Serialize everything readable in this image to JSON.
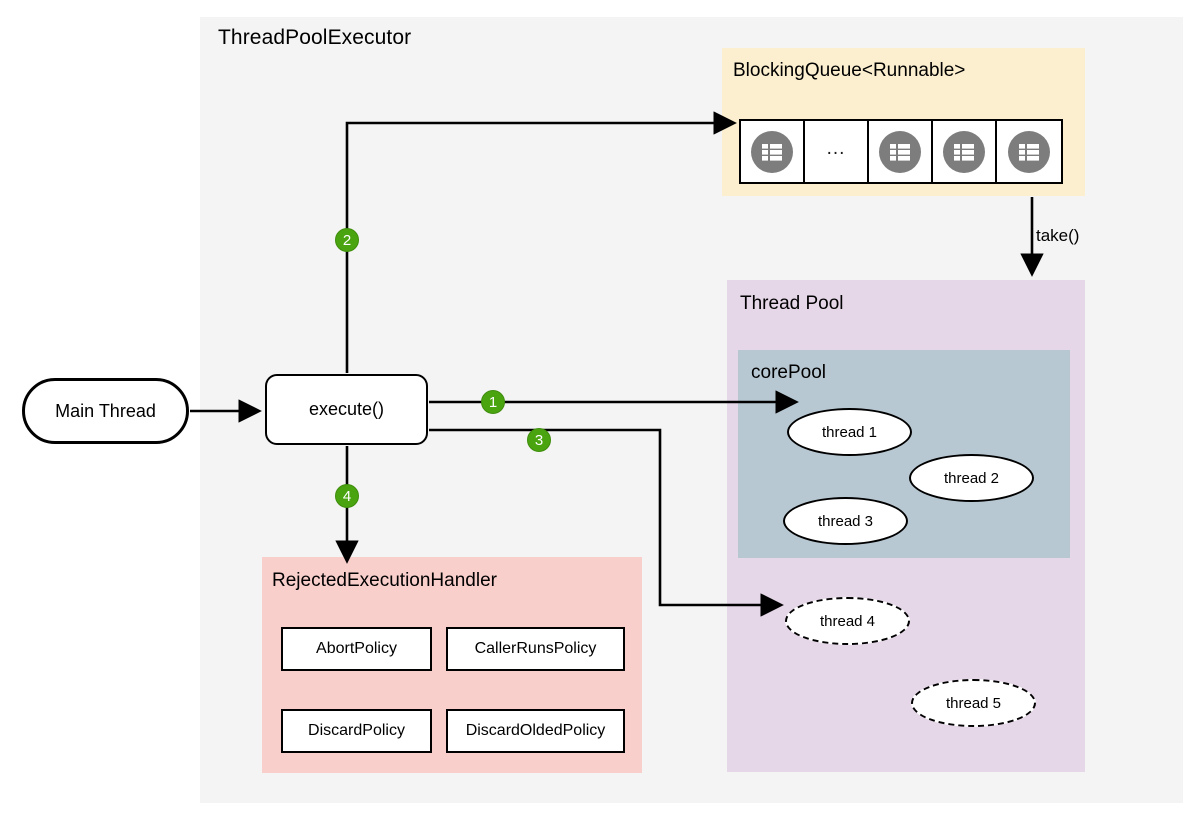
{
  "diagram": {
    "title": "ThreadPoolExecutor",
    "type": "flow-diagram"
  },
  "main_thread": {
    "label": "Main Thread"
  },
  "execute": {
    "label": "execute()"
  },
  "queue": {
    "title": "BlockingQueue<Runnable>",
    "cells": [
      {
        "kind": "task",
        "label": ""
      },
      {
        "kind": "ellipsis",
        "label": "..."
      },
      {
        "kind": "task",
        "label": ""
      },
      {
        "kind": "task",
        "label": ""
      },
      {
        "kind": "task",
        "label": ""
      }
    ],
    "icon_name": "task-list-icon",
    "background": "#fcefd0"
  },
  "thread_pool": {
    "title": "Thread Pool",
    "background": "#e5d6e8",
    "core_pool": {
      "title": "corePool",
      "background": "#b8c8d2",
      "threads": [
        {
          "label": "thread 1",
          "style": "solid"
        },
        {
          "label": "thread 2",
          "style": "solid"
        },
        {
          "label": "thread 3",
          "style": "solid"
        }
      ]
    },
    "extra_threads": [
      {
        "label": "thread 4",
        "style": "dashed"
      },
      {
        "label": "thread 5",
        "style": "dashed"
      }
    ]
  },
  "rejected_handler": {
    "title": "RejectedExecutionHandler",
    "background": "#f9cfcc",
    "policies": [
      "AbortPolicy",
      "CallerRunsPolicy",
      "DiscardPolicy",
      "DiscardOldedPolicy"
    ]
  },
  "steps": [
    {
      "number": "1",
      "meaning": "execute to corePool thread"
    },
    {
      "number": "2",
      "meaning": "execute to blocking queue"
    },
    {
      "number": "3",
      "meaning": "execute to extra thread"
    },
    {
      "number": "4",
      "meaning": "execute to rejected execution handler"
    }
  ],
  "edge_labels": {
    "take": "take()"
  },
  "colors": {
    "container_bg": "#f4f4f4",
    "queue_bg": "#fcefd0",
    "thread_pool_bg": "#e5d6e8",
    "core_pool_bg": "#b8c8d2",
    "rejected_bg": "#f9cfcc",
    "badge_green": "#4aa410",
    "icon_gray": "#7d7d7d",
    "stroke": "#000000"
  }
}
